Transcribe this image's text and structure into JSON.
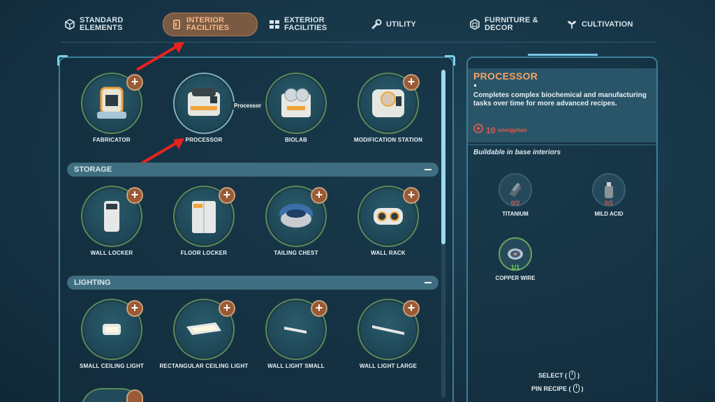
{
  "tabs": [
    {
      "label": "STANDARD\nELEMENTS",
      "icon": "cube-icon"
    },
    {
      "label": "INTERIOR\nFACILITIES",
      "icon": "door-icon",
      "active": true
    },
    {
      "label": "EXTERIOR\nFACILITIES",
      "icon": "blocks-icon"
    },
    {
      "label": "UTILITY",
      "icon": "wrench-icon"
    },
    {
      "label": "FURNITURE &\nDECOR",
      "icon": "box-icon"
    },
    {
      "label": "CULTIVATION",
      "icon": "plant-icon"
    }
  ],
  "facilities": [
    {
      "name": "FABRICATOR",
      "plus": "+"
    },
    {
      "name": "PROCESSOR",
      "tooltip": "Processor"
    },
    {
      "name": "BIOLAB"
    },
    {
      "name": "MODIFICATION STATION",
      "plus": "+"
    }
  ],
  "sections": {
    "storage": "STORAGE",
    "lighting": "LIGHTING"
  },
  "storage": [
    {
      "name": "WALL LOCKER"
    },
    {
      "name": "FLOOR LOCKER"
    },
    {
      "name": "TAILING CHEST"
    },
    {
      "name": "WALL RACK"
    }
  ],
  "lighting": [
    {
      "name": "SMALL CEILING LIGHT"
    },
    {
      "name": "RECTANGULAR CEILING LIGHT"
    },
    {
      "name": "WALL LIGHT SMALL"
    },
    {
      "name": "WALL LIGHT LARGE"
    }
  ],
  "plus": "+",
  "detail": {
    "title": "PROCESSOR",
    "description": "Completes complex biochemical and manufacturing tasks over time for more advanced recipes.",
    "energy_value": "10",
    "energy_unit": "energy/sec",
    "buildable": "Buildable in base interiors",
    "resources": [
      {
        "name": "TITANIUM",
        "count": "0/2",
        "color": "#e05a4a"
      },
      {
        "name": "MILD ACID",
        "count": "0/1",
        "color": "#e05a4a"
      },
      {
        "name": "COPPER WIRE",
        "count": "1/1",
        "color": "#7bd35a"
      }
    ]
  },
  "hints": {
    "select": "SELECT (",
    "select_end": ")",
    "pin": "PIN RECIPE (",
    "pin_end": ")"
  },
  "colors": {
    "accent": "#f4a266",
    "panel_border": "#3a7f98",
    "warning": "#e85b4b",
    "ok": "#7bd35a"
  }
}
